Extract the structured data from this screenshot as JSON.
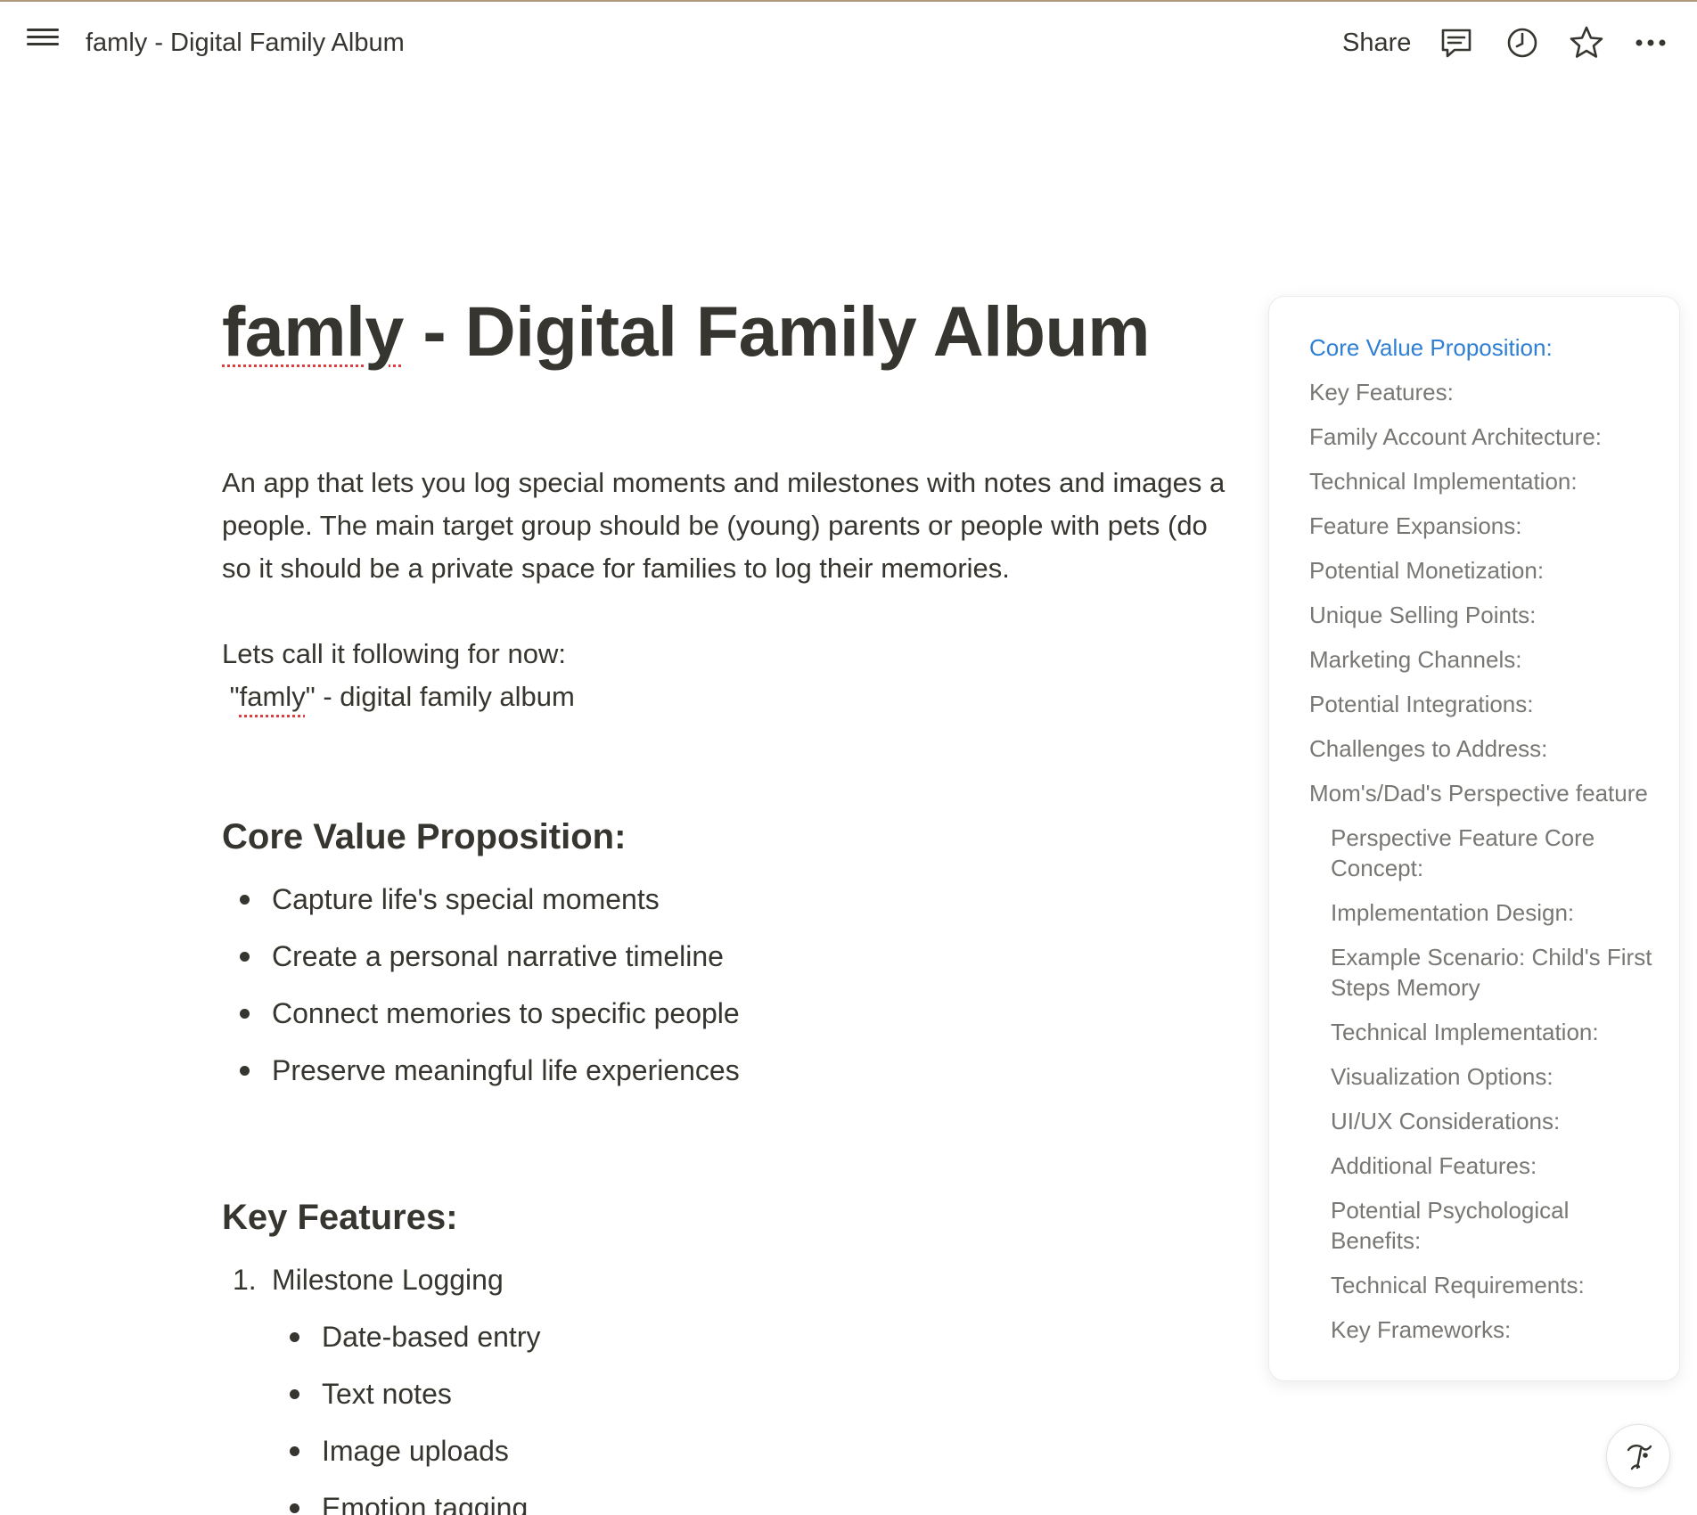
{
  "topbar": {
    "breadcrumb": "famly - Digital Family Album",
    "share_label": "Share"
  },
  "doc": {
    "title_part1": "famly",
    "title_part2": " - Digital Family Album",
    "intro_lines": [
      "An app that lets you log special moments and milestones with notes and images a",
      "people. The main target group should be (young) parents or people with pets (do",
      "so it should be a private space for families to log their memories."
    ],
    "lets_line1": "Lets call it following for now:",
    "lets_line2_prefix": " \"",
    "lets_line2_word": "famly",
    "lets_line2_suffix": "\" - digital family album",
    "core_heading": "Core Value Proposition:",
    "core_items": [
      "Capture life's special moments",
      "Create a personal narrative timeline",
      "Connect memories to specific people",
      "Preserve meaningful life experiences"
    ],
    "key_heading": "Key Features:",
    "key_item1_num": "1.",
    "key_item1_label": "Milestone Logging",
    "key_item1_subitems": [
      "Date-based entry",
      "Text notes",
      "Image uploads",
      "Emotion tagging"
    ]
  },
  "toc": {
    "items": [
      {
        "label": "Core Value Proposition:",
        "level": 1,
        "active": true
      },
      {
        "label": "Key Features:",
        "level": 1
      },
      {
        "label": "Family Account Architecture:",
        "level": 1
      },
      {
        "label": "Technical Implementation:",
        "level": 1
      },
      {
        "label": "Feature Expansions:",
        "level": 1
      },
      {
        "label": "Potential Monetization:",
        "level": 1
      },
      {
        "label": "Unique Selling Points:",
        "level": 1
      },
      {
        "label": "Marketing Channels:",
        "level": 1
      },
      {
        "label": "Potential Integrations:",
        "level": 1
      },
      {
        "label": "Challenges to Address:",
        "level": 1
      },
      {
        "label": "Mom's/Dad's Perspective feature",
        "level": 1
      },
      {
        "label": "Perspective Feature Core Concept:",
        "level": 2
      },
      {
        "label": "Implementation Design:",
        "level": 2
      },
      {
        "label": "Example Scenario: Child's First Steps Memory",
        "level": 2
      },
      {
        "label": "Technical Implementation:",
        "level": 2
      },
      {
        "label": "Visualization Options:",
        "level": 2
      },
      {
        "label": "UI/UX Considerations:",
        "level": 2
      },
      {
        "label": "Additional Features:",
        "level": 2
      },
      {
        "label": "Potential Psychological Benefits:",
        "level": 2
      },
      {
        "label": "Technical Requirements:",
        "level": 2
      },
      {
        "label": "Key Frameworks:",
        "level": 2
      }
    ]
  },
  "icons": {
    "menu": "hamburger-icon",
    "comments": "comment-icon",
    "history": "clock-icon",
    "favorite": "star-icon",
    "more": "more-dots-icon",
    "ai": "notion-ai-icon"
  },
  "colors": {
    "text": "#37352f",
    "muted": "#787774",
    "accent": "#2f7fd3",
    "spell_error": "#e03e3e"
  }
}
